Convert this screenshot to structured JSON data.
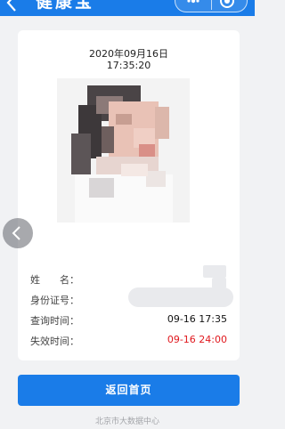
{
  "header": {
    "title": "健康宝",
    "back_icon": "chevron-left-icon",
    "menu_icon": "more-dots-icon",
    "close_icon": "target-icon"
  },
  "card": {
    "date": "2020年09月16日",
    "time": "17:35:20",
    "fields": [
      {
        "label": "姓　　名：",
        "value": ""
      },
      {
        "label": "身份证号：",
        "value": ""
      },
      {
        "label": "查询时间：",
        "value": "09-16 17:35"
      },
      {
        "label": "失效时间：",
        "value": "09-16 24:00"
      }
    ]
  },
  "colors": {
    "primary": "#1a7ce8",
    "expire_red": "#e0171d",
    "background": "#f1f2f4"
  },
  "side_button_icon": "chevron-left-icon",
  "return_button": "返回首页",
  "footer": "北京市大数据中心"
}
